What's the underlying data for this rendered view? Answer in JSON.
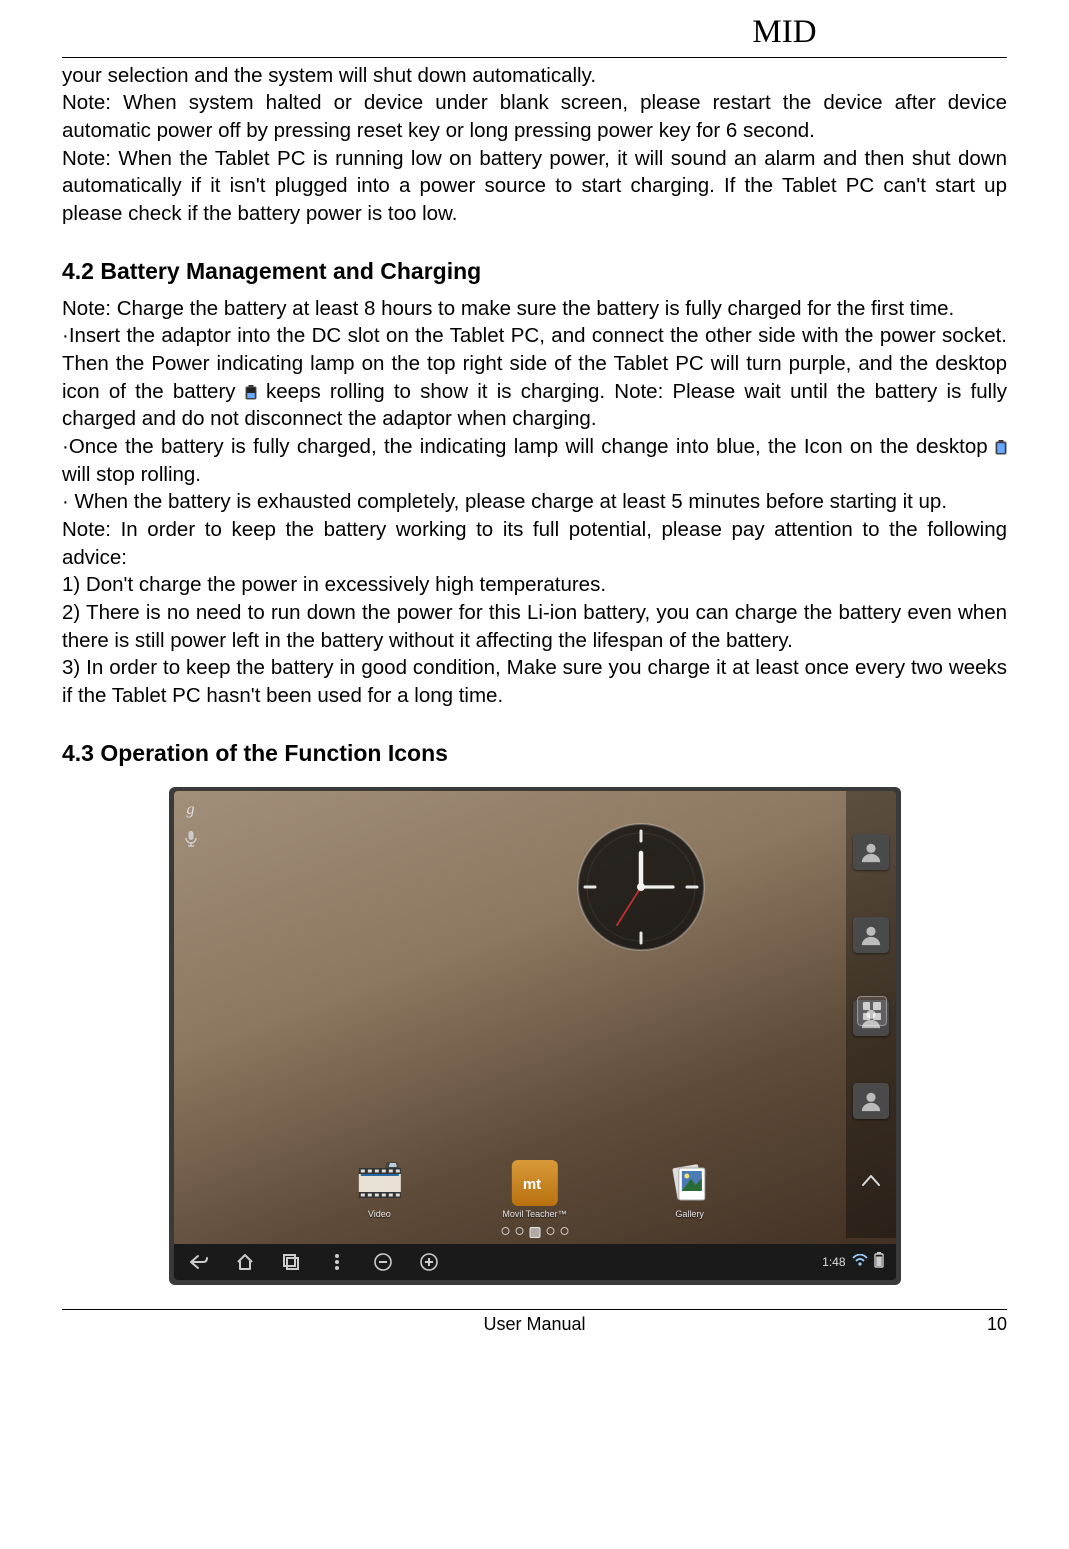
{
  "header": {
    "title": "MID"
  },
  "body": {
    "intro_p1": "your selection and the system will shut down automatically.",
    "intro_p2": "Note: When system halted or device under blank screen, please restart the device after device automatic power off by pressing reset key or long pressing power key for 6 second.",
    "intro_p3": "Note: When the Tablet PC is running low on battery power, it will sound an alarm and then shut down automatically if it isn't plugged into a power source to start charging. If the Tablet PC can't start up please check if the battery power is too low.",
    "heading_42": "4.2 Battery Management and Charging",
    "s42_p1": "Note: Charge the battery at least 8 hours to make sure the battery is fully charged for the first time.",
    "s42_p2a": "·Insert the adaptor into the DC slot on the Tablet PC, and connect the other side with the power socket. Then the Power indicating lamp on the top right side of the Tablet PC will turn purple, and the desktop icon of the battery ",
    "s42_p2b": " keeps rolling to show it is charging. Note: Please wait until the battery is fully charged and do not disconnect the adaptor when charging.",
    "s42_p3a": "·Once the battery is fully charged, the indicating lamp will change into blue, the Icon on the desktop ",
    "s42_p3b": " will stop rolling.",
    "s42_p4": "· When the battery is exhausted completely, please charge at least 5 minutes before starting it up.",
    "s42_p5": "Note: In order to keep the battery working to its full potential, please pay attention to the following advice:",
    "s42_p6": "1) Don't charge the power in excessively high temperatures.",
    "s42_p7": "2) There is no need to run down the power for this Li-ion battery, you can charge the battery even when there is still power left in the battery without it affecting the lifespan of the battery.",
    "s42_p8": "3) In order to keep the battery in good condition, Make sure you charge it at least once every two weeks if the Tablet PC hasn't been used for a long time.",
    "heading_43": "4.3 Operation of the Function Icons"
  },
  "tablet": {
    "dock": {
      "items": [
        {
          "label": "Video"
        },
        {
          "label": "Movil Teacher™"
        },
        {
          "label": "Gallery"
        }
      ]
    },
    "status": {
      "time": "1:48",
      "battery_icon": "battery"
    }
  },
  "footer": {
    "center": "User Manual",
    "page": "10"
  }
}
